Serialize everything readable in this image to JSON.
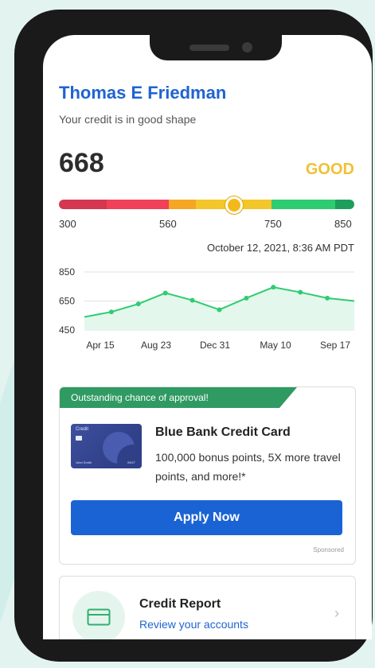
{
  "profile": {
    "name": "Thomas E Friedman",
    "status_text": "Your credit is in good shape"
  },
  "score": {
    "value": "668",
    "rating": "GOOD",
    "rating_color": "#efc135",
    "min": 300,
    "max": 850,
    "scale_labels": [
      "300",
      "560",
      "750",
      "850"
    ],
    "timestamp": "October 12, 2021, 8:36 AM PDT"
  },
  "chart_data": {
    "type": "area",
    "y_ticks": [
      "850",
      "650",
      "450"
    ],
    "ylim": [
      450,
      850
    ],
    "x_labels": [
      "Apr 15",
      "Aug 23",
      "Dec 31",
      "May 10",
      "Sep 17"
    ],
    "values": [
      540,
      575,
      630,
      705,
      655,
      590,
      670,
      745,
      710,
      670,
      650
    ],
    "line_color": "#2ecc71",
    "fill_color": "#e3f7ec"
  },
  "offer": {
    "banner": "Outstanding chance of approval!",
    "card_brand": "Credit",
    "card_holder": "John Smith",
    "card_exp": "09/27",
    "title": "Blue Bank Credit Card",
    "description": "100,000 bonus points, 5X more travel points, and more!*",
    "apply_label": "Apply Now",
    "sponsored": "Sponsored",
    "accent": "#2f9a62",
    "button_color": "#1a63d4"
  },
  "report": {
    "title": "Credit Report",
    "link": "Review your accounts",
    "icon": "credit-card-icon"
  }
}
